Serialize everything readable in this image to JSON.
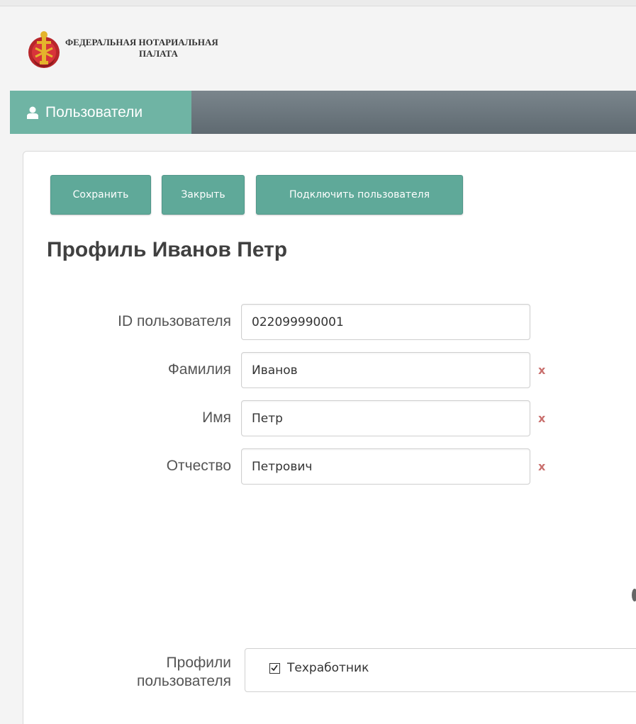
{
  "header": {
    "org_name_line1": "ФЕДЕРАЛЬНАЯ НОТАРИАЛЬНАЯ",
    "org_name_line2": "ПАЛАТА",
    "emblem_icon": "notary-emblem-icon"
  },
  "nav": {
    "active_tab_label": "Пользователи",
    "active_tab_icon": "user-icon"
  },
  "toolbar": {
    "save_label": "Сохранить",
    "close_label": "Закрыть",
    "connect_label": "Подключить пользователя"
  },
  "profile": {
    "title": "Профиль Иванов Петр"
  },
  "form": {
    "user_id": {
      "label": "ID пользователя",
      "value": "022099990001"
    },
    "last_name": {
      "label": "Фамилия",
      "value": "Иванов",
      "clear": "x"
    },
    "first_name": {
      "label": "Имя",
      "value": "Петр",
      "clear": "x"
    },
    "middle_name": {
      "label": "Отчество",
      "value": "Петрович",
      "clear": "x"
    },
    "profiles": {
      "label_line1": "Профили",
      "label_line2": "пользователя",
      "options": [
        {
          "label": "Техработник",
          "checked": true
        }
      ]
    }
  },
  "colors": {
    "accent": "#5fa999",
    "nav_tab": "#6fb4a4",
    "navbar": "#6b767d",
    "required_mark": "#c9706e"
  }
}
